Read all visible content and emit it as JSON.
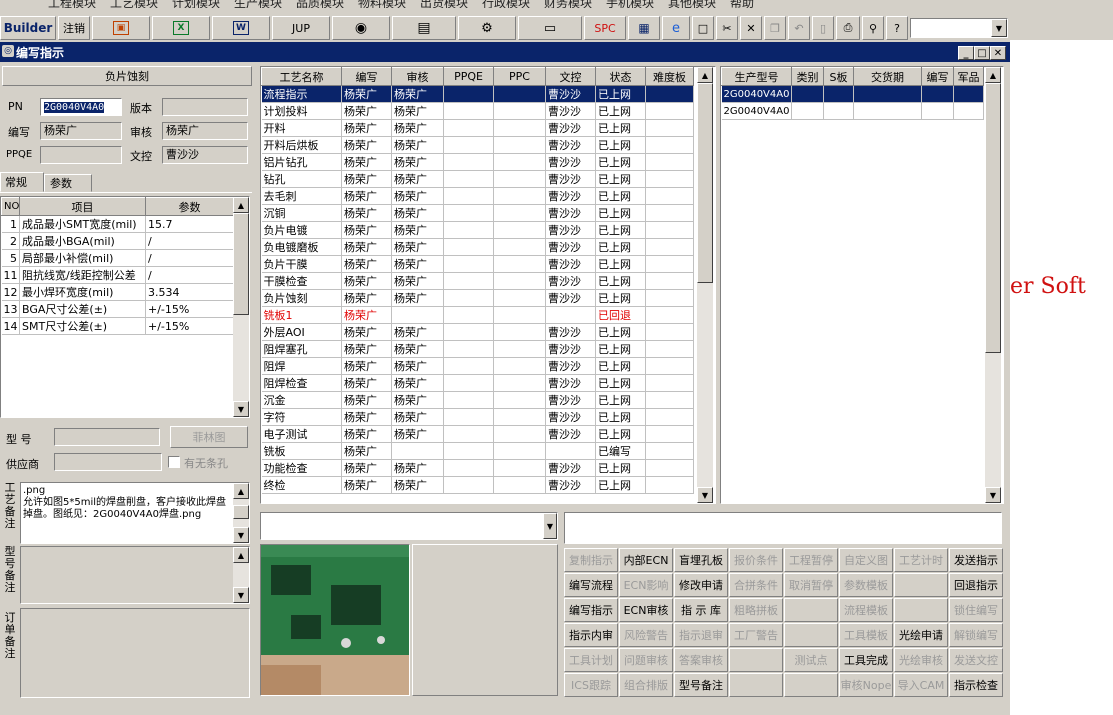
{
  "menu": [
    "工程模块",
    "工艺模块",
    "计划模块",
    "生产模块",
    "品质模块",
    "物料模块",
    "出货模块",
    "行政模块",
    "财务模块",
    "手机模块",
    "其他模块",
    "帮助"
  ],
  "toolbar": {
    "builder": "Builder",
    "logout": "注销",
    "jup": "JUP",
    "spc": "SPC",
    "icons": [
      "window-icon",
      "excel-icon",
      "word-icon",
      "eye-icon",
      "database-icon",
      "tools-icon",
      "computer-icon",
      "calc-icon",
      "ie-icon",
      "new-icon",
      "cut-icon",
      "delete-icon",
      "copy-icon",
      "undo-icon",
      "preview-icon",
      "print-icon",
      "find-icon",
      "help-icon"
    ]
  },
  "desktop": {
    "bg_text": "er Soft"
  },
  "window": {
    "title": "编写指示"
  },
  "left": {
    "header": "负片蚀刻",
    "pn_label": "PN",
    "pn_value": "2G0040V4A0",
    "version_label": "版本",
    "version_value": "",
    "writer_label": "编写",
    "writer_value": "杨荣广",
    "review_label": "审核",
    "review_value": "杨荣广",
    "ppqe_label": "PPQE",
    "ppqe_value": "",
    "control_label": "文控",
    "control_value": "曹沙沙",
    "tabs": [
      "常规",
      "参数"
    ],
    "param_headers": [
      "NO",
      "项目",
      "参数"
    ],
    "params": [
      [
        "1",
        "成品最小SMT宽度(mil)",
        "15.7"
      ],
      [
        "2",
        "成品最小BGA(mil)",
        "/"
      ],
      [
        "5",
        "局部最小补偿(mil)",
        "/"
      ],
      [
        "11",
        "阻抗线宽/线距控制公差",
        "/"
      ],
      [
        "12",
        "最小焊环宽度(mil)",
        "3.534"
      ],
      [
        "13",
        "BGA尺寸公差(±)",
        "+/-15%"
      ],
      [
        "14",
        "SMT尺寸公差(±)",
        "+/-15%"
      ]
    ],
    "model_label": "型 号",
    "model_value": "",
    "philin_button": "菲林图",
    "supplier_label": "供应商",
    "supplier_value": "",
    "no_hole_label": "有无条孔",
    "process_note_label": "工艺备注",
    "process_note": ".png\n允许如图5*5mil的焊盘削盘，客户接收此焊盘掉盘。图纸见：2G0040V4A0焊盘.png",
    "model_note_label": "型号备注",
    "order_note_label": "订单备注"
  },
  "process": {
    "headers": [
      "工艺名称",
      "编写",
      "审核",
      "PPQE",
      "PPC",
      "文控",
      "状态",
      "难度板"
    ],
    "rows": [
      [
        "流程指示",
        "杨荣广",
        "杨荣广",
        "",
        "",
        "曹沙沙",
        "已上网",
        ""
      ],
      [
        "计划投料",
        "杨荣广",
        "杨荣广",
        "",
        "",
        "曹沙沙",
        "已上网",
        ""
      ],
      [
        "开料",
        "杨荣广",
        "杨荣广",
        "",
        "",
        "曹沙沙",
        "已上网",
        ""
      ],
      [
        "开料后烘板",
        "杨荣广",
        "杨荣广",
        "",
        "",
        "曹沙沙",
        "已上网",
        ""
      ],
      [
        "铝片钻孔",
        "杨荣广",
        "杨荣广",
        "",
        "",
        "曹沙沙",
        "已上网",
        ""
      ],
      [
        "钻孔",
        "杨荣广",
        "杨荣广",
        "",
        "",
        "曹沙沙",
        "已上网",
        ""
      ],
      [
        "去毛刺",
        "杨荣广",
        "杨荣广",
        "",
        "",
        "曹沙沙",
        "已上网",
        ""
      ],
      [
        "沉铜",
        "杨荣广",
        "杨荣广",
        "",
        "",
        "曹沙沙",
        "已上网",
        ""
      ],
      [
        "负片电镀",
        "杨荣广",
        "杨荣广",
        "",
        "",
        "曹沙沙",
        "已上网",
        ""
      ],
      [
        "负电镀磨板",
        "杨荣广",
        "杨荣广",
        "",
        "",
        "曹沙沙",
        "已上网",
        ""
      ],
      [
        "负片干膜",
        "杨荣广",
        "杨荣广",
        "",
        "",
        "曹沙沙",
        "已上网",
        ""
      ],
      [
        "干膜检查",
        "杨荣广",
        "杨荣广",
        "",
        "",
        "曹沙沙",
        "已上网",
        ""
      ],
      [
        "负片蚀刻",
        "杨荣广",
        "杨荣广",
        "",
        "",
        "曹沙沙",
        "已上网",
        ""
      ],
      [
        "铣板1",
        "杨荣广",
        "",
        "",
        "",
        "",
        "已回退",
        ""
      ],
      [
        "外层AOI",
        "杨荣广",
        "杨荣广",
        "",
        "",
        "曹沙沙",
        "已上网",
        ""
      ],
      [
        "阻焊塞孔",
        "杨荣广",
        "杨荣广",
        "",
        "",
        "曹沙沙",
        "已上网",
        ""
      ],
      [
        "阻焊",
        "杨荣广",
        "杨荣广",
        "",
        "",
        "曹沙沙",
        "已上网",
        ""
      ],
      [
        "阻焊检查",
        "杨荣广",
        "杨荣广",
        "",
        "",
        "曹沙沙",
        "已上网",
        ""
      ],
      [
        "沉金",
        "杨荣广",
        "杨荣广",
        "",
        "",
        "曹沙沙",
        "已上网",
        ""
      ],
      [
        "字符",
        "杨荣广",
        "杨荣广",
        "",
        "",
        "曹沙沙",
        "已上网",
        ""
      ],
      [
        "电子测试",
        "杨荣广",
        "杨荣广",
        "",
        "",
        "曹沙沙",
        "已上网",
        ""
      ],
      [
        "铣板",
        "杨荣广",
        "",
        "",
        "",
        "",
        "已编写",
        ""
      ],
      [
        "功能检查",
        "杨荣广",
        "杨荣广",
        "",
        "",
        "曹沙沙",
        "已上网",
        ""
      ],
      [
        "终检",
        "杨荣广",
        "杨荣广",
        "",
        "",
        "曹沙沙",
        "已上网",
        ""
      ]
    ]
  },
  "models": {
    "headers": [
      "生产型号",
      "类别",
      "S板",
      "交货期",
      "编写",
      "军品"
    ],
    "rows": [
      [
        "2G0040V4A0",
        "",
        "",
        "",
        "",
        ""
      ],
      [
        "2G0040V4A0",
        "",
        "",
        "",
        "",
        ""
      ]
    ]
  },
  "buttons": [
    [
      {
        "t": "复制指示",
        "d": true
      },
      {
        "t": "内部ECN",
        "d": false
      },
      {
        "t": "盲埋孔板",
        "d": false
      },
      {
        "t": "报价条件",
        "d": true
      },
      {
        "t": "工程暂停",
        "d": true
      },
      {
        "t": "自定义图",
        "d": true
      },
      {
        "t": "工艺计时",
        "d": true
      },
      {
        "t": "发送指示",
        "d": false
      }
    ],
    [
      {
        "t": "编写流程",
        "d": false
      },
      {
        "t": "ECN影响",
        "d": true
      },
      {
        "t": "修改申请",
        "d": false
      },
      {
        "t": "合拼条件",
        "d": true
      },
      {
        "t": "取消暂停",
        "d": true
      },
      {
        "t": "参数模板",
        "d": true
      },
      {
        "t": "",
        "d": true
      },
      {
        "t": "回退指示",
        "d": false
      }
    ],
    [
      {
        "t": "编写指示",
        "d": false
      },
      {
        "t": "ECN审核",
        "d": false
      },
      {
        "t": "指 示 库",
        "d": false
      },
      {
        "t": "粗略拼板",
        "d": true
      },
      {
        "t": "",
        "d": true
      },
      {
        "t": "流程模板",
        "d": true
      },
      {
        "t": "",
        "d": true
      },
      {
        "t": "锁住编写",
        "d": true
      }
    ],
    [
      {
        "t": "指示内审",
        "d": false
      },
      {
        "t": "风险警告",
        "d": true
      },
      {
        "t": "指示退审",
        "d": true
      },
      {
        "t": "工厂警告",
        "d": true
      },
      {
        "t": "",
        "d": true
      },
      {
        "t": "工具模板",
        "d": true
      },
      {
        "t": "光绘申请",
        "d": false
      },
      {
        "t": "解锁编写",
        "d": true
      }
    ],
    [
      {
        "t": "工具计划",
        "d": true
      },
      {
        "t": "问题审核",
        "d": true
      },
      {
        "t": "答案审核",
        "d": true
      },
      {
        "t": "",
        "d": true
      },
      {
        "t": "测试点",
        "d": true
      },
      {
        "t": "工具完成",
        "d": false
      },
      {
        "t": "光绘审核",
        "d": true
      },
      {
        "t": "发送文控",
        "d": true
      }
    ],
    [
      {
        "t": "ICS跟踪",
        "d": true
      },
      {
        "t": "组合排版",
        "d": true
      },
      {
        "t": "型号备注",
        "d": false
      },
      {
        "t": "",
        "d": true
      },
      {
        "t": "",
        "d": true
      },
      {
        "t": "审核Nope",
        "d": true
      },
      {
        "t": "导入CAM",
        "d": true
      },
      {
        "t": "指示检查",
        "d": false
      }
    ]
  ]
}
